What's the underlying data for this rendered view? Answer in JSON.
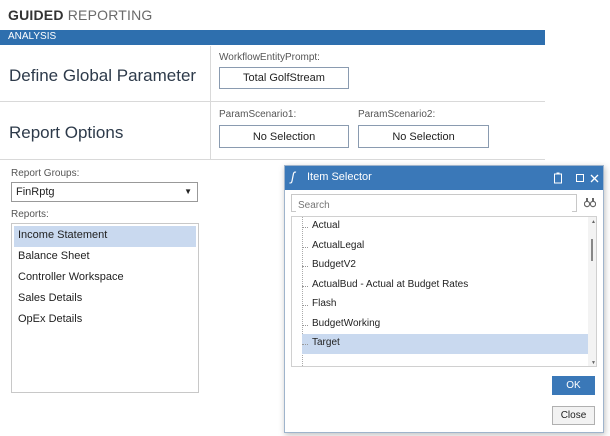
{
  "app": {
    "title_bold": "GUIDED",
    "title_light": "REPORTING"
  },
  "tab": {
    "label": "ANALYSIS"
  },
  "global_param": {
    "section_label": "Define Global Parameter",
    "prompt_label": "WorkflowEntityPrompt:",
    "prompt_value": "Total GolfStream"
  },
  "report_options": {
    "section_label": "Report Options",
    "scenario1_label": "ParamScenario1:",
    "scenario1_value": "No Selection",
    "scenario2_label": "ParamScenario2:",
    "scenario2_value": "No Selection"
  },
  "left_panel": {
    "groups_label": "Report Groups:",
    "groups_value": "FinRptg",
    "reports_label": "Reports:",
    "reports": [
      "Income Statement",
      "Balance Sheet",
      "Controller Workspace",
      "Sales Details",
      "OpEx Details"
    ],
    "selected_index": 0
  },
  "item_selector": {
    "title": "Item Selector",
    "search_placeholder": "Search",
    "items": [
      "Actual",
      "ActualLegal",
      "BudgetV2",
      "ActualBud - Actual at Budget Rates",
      "Flash",
      "BudgetWorking",
      "Target"
    ],
    "selected_index": 6,
    "ok_label": "OK",
    "close_label": "Close",
    "accent_color": "#3a78b8"
  }
}
